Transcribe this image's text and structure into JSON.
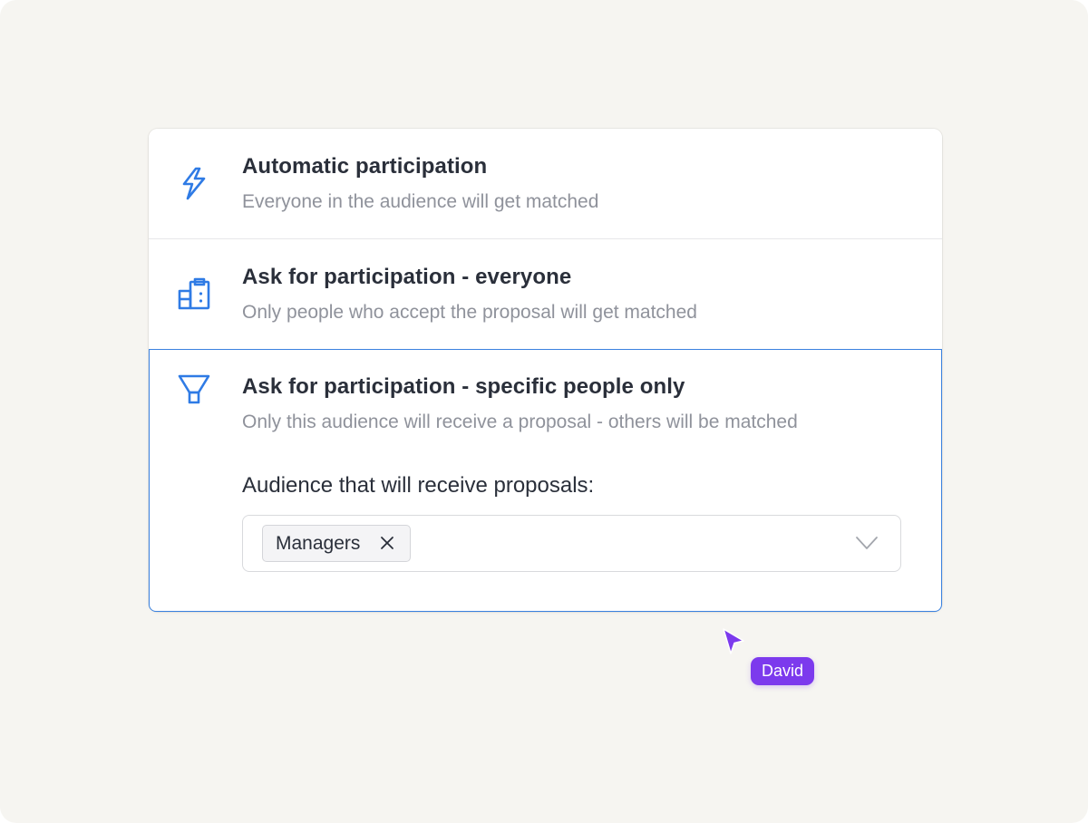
{
  "colors": {
    "accent": "#3b82e0",
    "cursor": "#7c3aed",
    "background": "#f6f5f1"
  },
  "options": [
    {
      "title": "Automatic participation",
      "description": "Everyone in the audience will get matched",
      "icon": "lightning-icon",
      "selected": false
    },
    {
      "title": "Ask for participation - everyone",
      "description": "Only people who accept the proposal will get matched",
      "icon": "clipboard-building-icon",
      "selected": false
    },
    {
      "title": "Ask for participation - specific people only",
      "description": "Only this audience will receive a proposal - others will be matched",
      "icon": "funnel-icon",
      "selected": true
    }
  ],
  "audience": {
    "label": "Audience that will receive proposals:",
    "tags": [
      "Managers"
    ]
  },
  "collaborator": {
    "name": "David"
  }
}
